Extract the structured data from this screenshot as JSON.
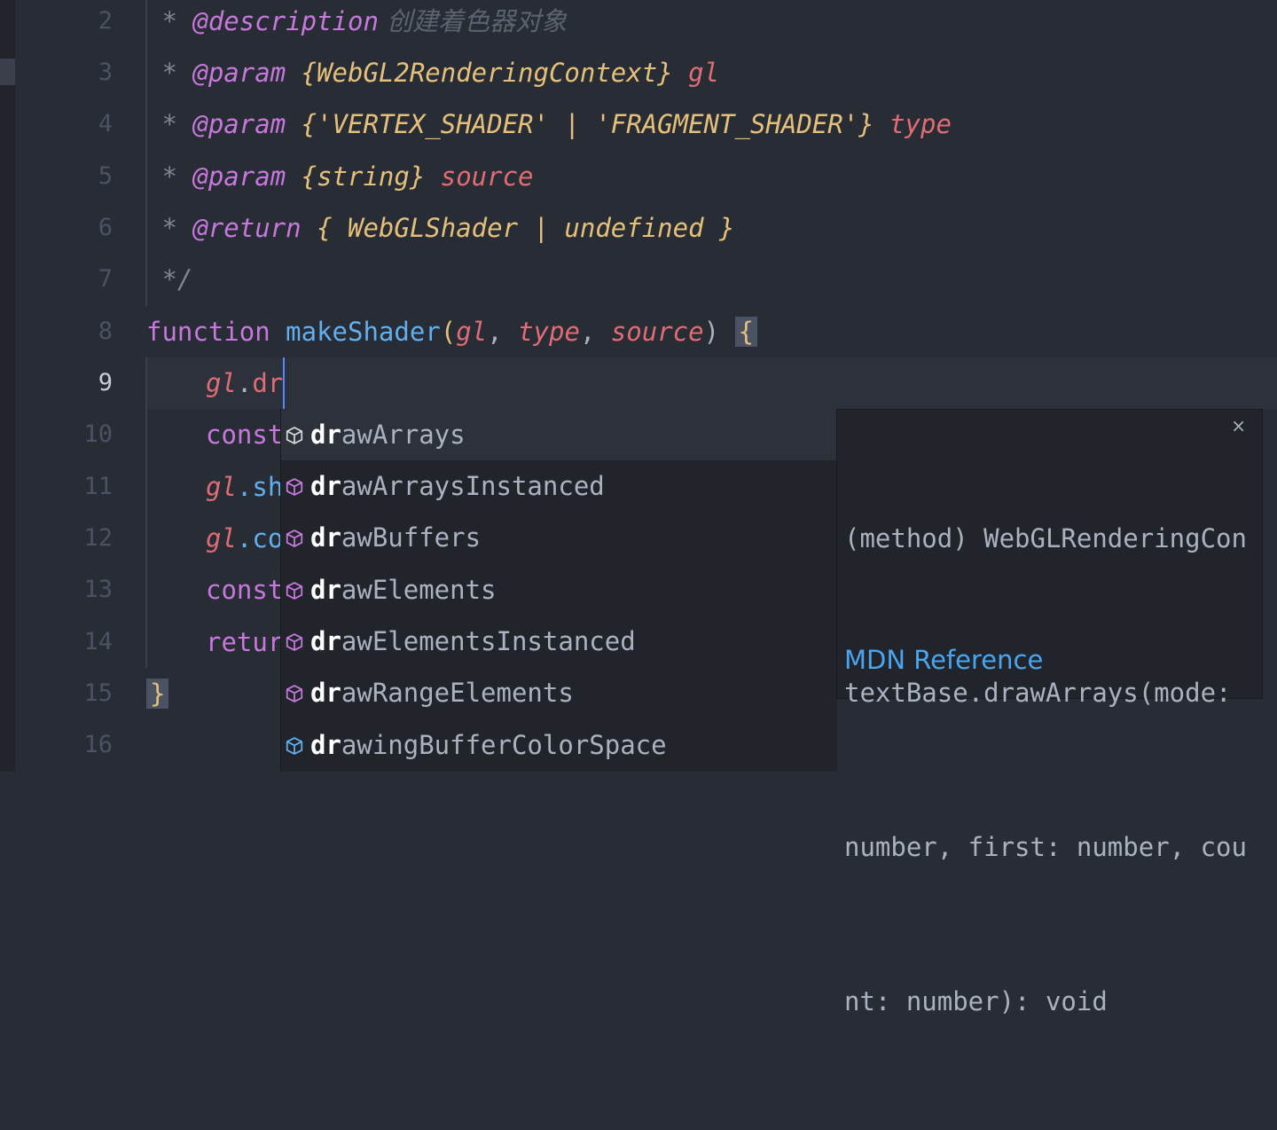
{
  "editor": {
    "line_numbers": [
      "2",
      "3",
      "4",
      "5",
      "6",
      "7",
      "8",
      "9",
      "10",
      "11",
      "12",
      "13",
      "14",
      "15",
      "16"
    ],
    "active_line": "9",
    "doc": {
      "l2": {
        "star": " * ",
        "tag": "@description",
        "text": " 创建着色器对象"
      },
      "l3": {
        "star": " * ",
        "tag": "@param",
        "type": " {WebGL2RenderingContext}",
        "name": " gl"
      },
      "l4": {
        "star": " * ",
        "tag": "@param",
        "type": " {'VERTEX_SHADER' | 'FRAGMENT_SHADER'}",
        "name": " type"
      },
      "l5": {
        "star": " * ",
        "tag": "@param",
        "type": " {string}",
        "name": " source"
      },
      "l6": {
        "star": " * ",
        "tag": "@return",
        "type": " { WebGLShader | undefined }"
      },
      "l7": {
        "text": " */"
      }
    },
    "l8": {
      "kw": "function",
      "fn": " makeShader",
      "open": "(",
      "p1": "gl",
      "c1": ", ",
      "p2": "type",
      "c2": ", ",
      "p3": "source",
      "close": ") ",
      "brace": "{"
    },
    "l9": {
      "obj": "gl",
      "dot": ".",
      "typed": "dr"
    },
    "partial": {
      "l10": "const",
      "l11_obj": "gl",
      "l11_rest": ".sh",
      "l12_obj": "gl",
      "l12_rest": ".co",
      "l13": "const",
      "l14": "retur"
    },
    "l15": {
      "brace": "}"
    }
  },
  "suggest": {
    "match": "dr",
    "items": [
      {
        "rest": "awArrays",
        "icon": "method-icon"
      },
      {
        "rest": "awArraysInstanced",
        "icon": "method-icon"
      },
      {
        "rest": "awBuffers",
        "icon": "method-icon"
      },
      {
        "rest": "awElements",
        "icon": "method-icon"
      },
      {
        "rest": "awElementsInstanced",
        "icon": "method-icon"
      },
      {
        "rest": "awRangeElements",
        "icon": "method-icon"
      },
      {
        "rest": "awingBufferColorSpace",
        "icon": "property-icon"
      }
    ],
    "selected_index": 0
  },
  "details": {
    "signature_lines": [
      "(method) WebGLRenderingCon",
      "textBase.drawArrays(mode:",
      "number, first: number, cou",
      "nt: number): void"
    ],
    "close_label": "×",
    "link": "MDN Reference"
  },
  "colors": {
    "background": "#282c34",
    "keyword": "#c678dd",
    "function": "#61afef",
    "variable": "#e06c75",
    "type": "#e5c07b",
    "link": "#4aa5f0"
  }
}
